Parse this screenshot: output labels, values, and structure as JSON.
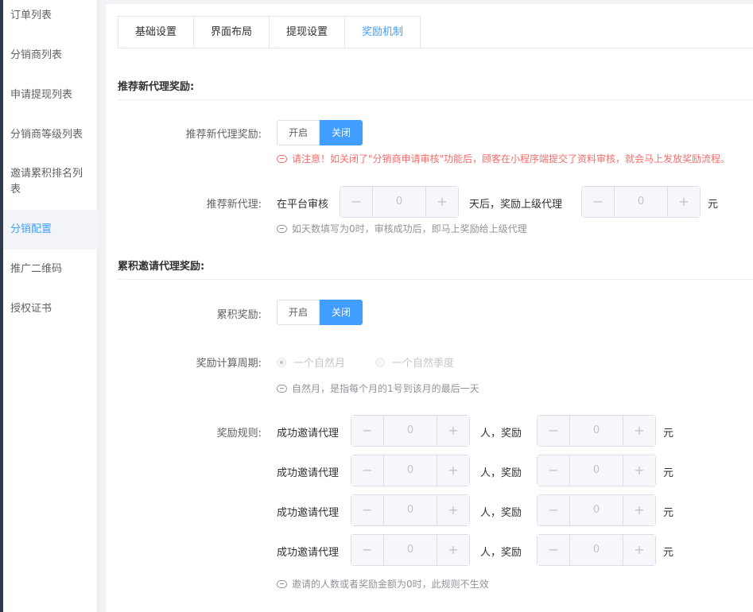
{
  "sidebar": {
    "items": [
      {
        "label": "订单列表"
      },
      {
        "label": "分销商列表"
      },
      {
        "label": "申请提现列表"
      },
      {
        "label": "分销商等级列表"
      },
      {
        "label": "邀请累积排名列表"
      },
      {
        "label": "分销配置",
        "active": true
      },
      {
        "label": "推广二维码"
      },
      {
        "label": "授权证书"
      }
    ]
  },
  "tabs": [
    {
      "label": "基础设置"
    },
    {
      "label": "界面布局"
    },
    {
      "label": "提现设置"
    },
    {
      "label": "奖励机制",
      "active": true
    }
  ],
  "section1": {
    "title": "推荐新代理奖励:",
    "reward_label": "推荐新代理奖励:",
    "switch": {
      "on_label": "开启",
      "off_label": "关闭",
      "selected": "关闭"
    },
    "warning": "请注意！如关闭了\"分销商申请审核\"功能后，顾客在小程序端提交了资料审核，就会马上发放奖励流程。",
    "agent_label": "推荐新代理:",
    "prefix": "在平台审核",
    "days_value": "0",
    "middle": "天后，奖励上级代理",
    "amount_value": "0",
    "unit": "元",
    "hint": "如天数填写为0时，审核成功后，即马上奖励给上级代理"
  },
  "section2": {
    "title": "累积邀请代理奖励:",
    "reward_label": "累积奖励:",
    "switch": {
      "on_label": "开启",
      "off_label": "关闭",
      "selected": "关闭"
    },
    "period_label": "奖励计算周期:",
    "period_options": [
      {
        "label": "一个自然月",
        "checked": true
      },
      {
        "label": "一个自然季度",
        "checked": false
      }
    ],
    "period_hint": "自然月，是指每个月的1号到该月的最后一天",
    "rules_label": "奖励规则:",
    "rules": [
      {
        "prefix": "成功邀请代理",
        "count": "0",
        "middle": "人，奖励",
        "amount": "0",
        "unit": "元"
      },
      {
        "prefix": "成功邀请代理",
        "count": "0",
        "middle": "人，奖励",
        "amount": "0",
        "unit": "元"
      },
      {
        "prefix": "成功邀请代理",
        "count": "0",
        "middle": "人，奖励",
        "amount": "0",
        "unit": "元"
      },
      {
        "prefix": "成功邀请代理",
        "count": "0",
        "middle": "人，奖励",
        "amount": "0",
        "unit": "元"
      }
    ],
    "rules_hint": "邀请的人数或者奖励金额为0时，此规则不生效"
  },
  "icons": {
    "minus": "−",
    "plus": "+",
    "info": "info-bubble-icon"
  },
  "colors": {
    "accent": "#409eff",
    "warning": "#f56c6c",
    "sidebar_edge": "#2f3a4e"
  }
}
